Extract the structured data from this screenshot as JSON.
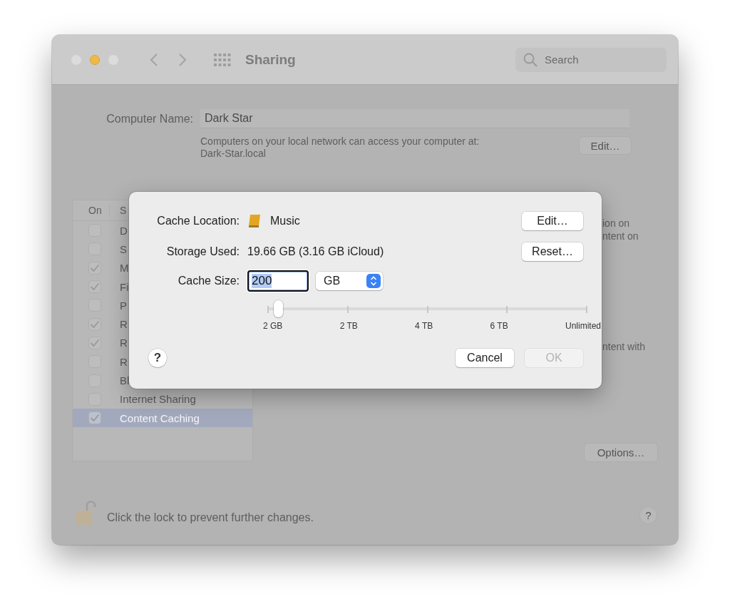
{
  "window": {
    "title": "Sharing",
    "search": {
      "placeholder": "Search"
    }
  },
  "computer_name": {
    "label": "Computer Name:",
    "value": "Dark Star",
    "note": "Computers on your local network can access your computer at:",
    "address": "Dark-Star.local",
    "edit_button": "Edit…"
  },
  "services": {
    "columns": [
      "On",
      "S"
    ],
    "rows": [
      {
        "name": "D",
        "checked": false,
        "selected": false
      },
      {
        "name": "S",
        "checked": false,
        "selected": false
      },
      {
        "name": "M",
        "checked": true,
        "selected": false
      },
      {
        "name": "Fi",
        "checked": true,
        "selected": false
      },
      {
        "name": "P",
        "checked": false,
        "selected": false
      },
      {
        "name": "R",
        "checked": true,
        "selected": false
      },
      {
        "name": "R",
        "checked": true,
        "selected": false
      },
      {
        "name": "R",
        "checked": false,
        "selected": false
      },
      {
        "name": "Bl",
        "checked": false,
        "selected": false
      },
      {
        "name": "Internet Sharing",
        "checked": false,
        "selected": false
      },
      {
        "name": "Content Caching",
        "checked": true,
        "selected": true
      }
    ]
  },
  "description_fragments": [
    "ion on",
    "ntent on",
    "ntent with"
  ],
  "options_button": "Options…",
  "lock": {
    "text": "Click the lock to prevent further changes."
  },
  "help_button": "?",
  "dialog": {
    "cache_location": {
      "label": "Cache Location:",
      "value": "Music",
      "button": "Edit…"
    },
    "storage_used": {
      "label": "Storage Used:",
      "value": "19.66 GB (3.16 GB iCloud)",
      "button": "Reset…"
    },
    "cache_size": {
      "label": "Cache Size:",
      "value": "200",
      "unit": "GB"
    },
    "slider": {
      "level": 0.033,
      "tick_labels": [
        "2 GB",
        "2 TB",
        "4 TB",
        "6 TB",
        "Unlimited"
      ]
    },
    "help_button": "?",
    "buttons": [
      {
        "label": "Cancel",
        "disabled": false
      },
      {
        "label": "OK",
        "disabled": true
      }
    ]
  }
}
